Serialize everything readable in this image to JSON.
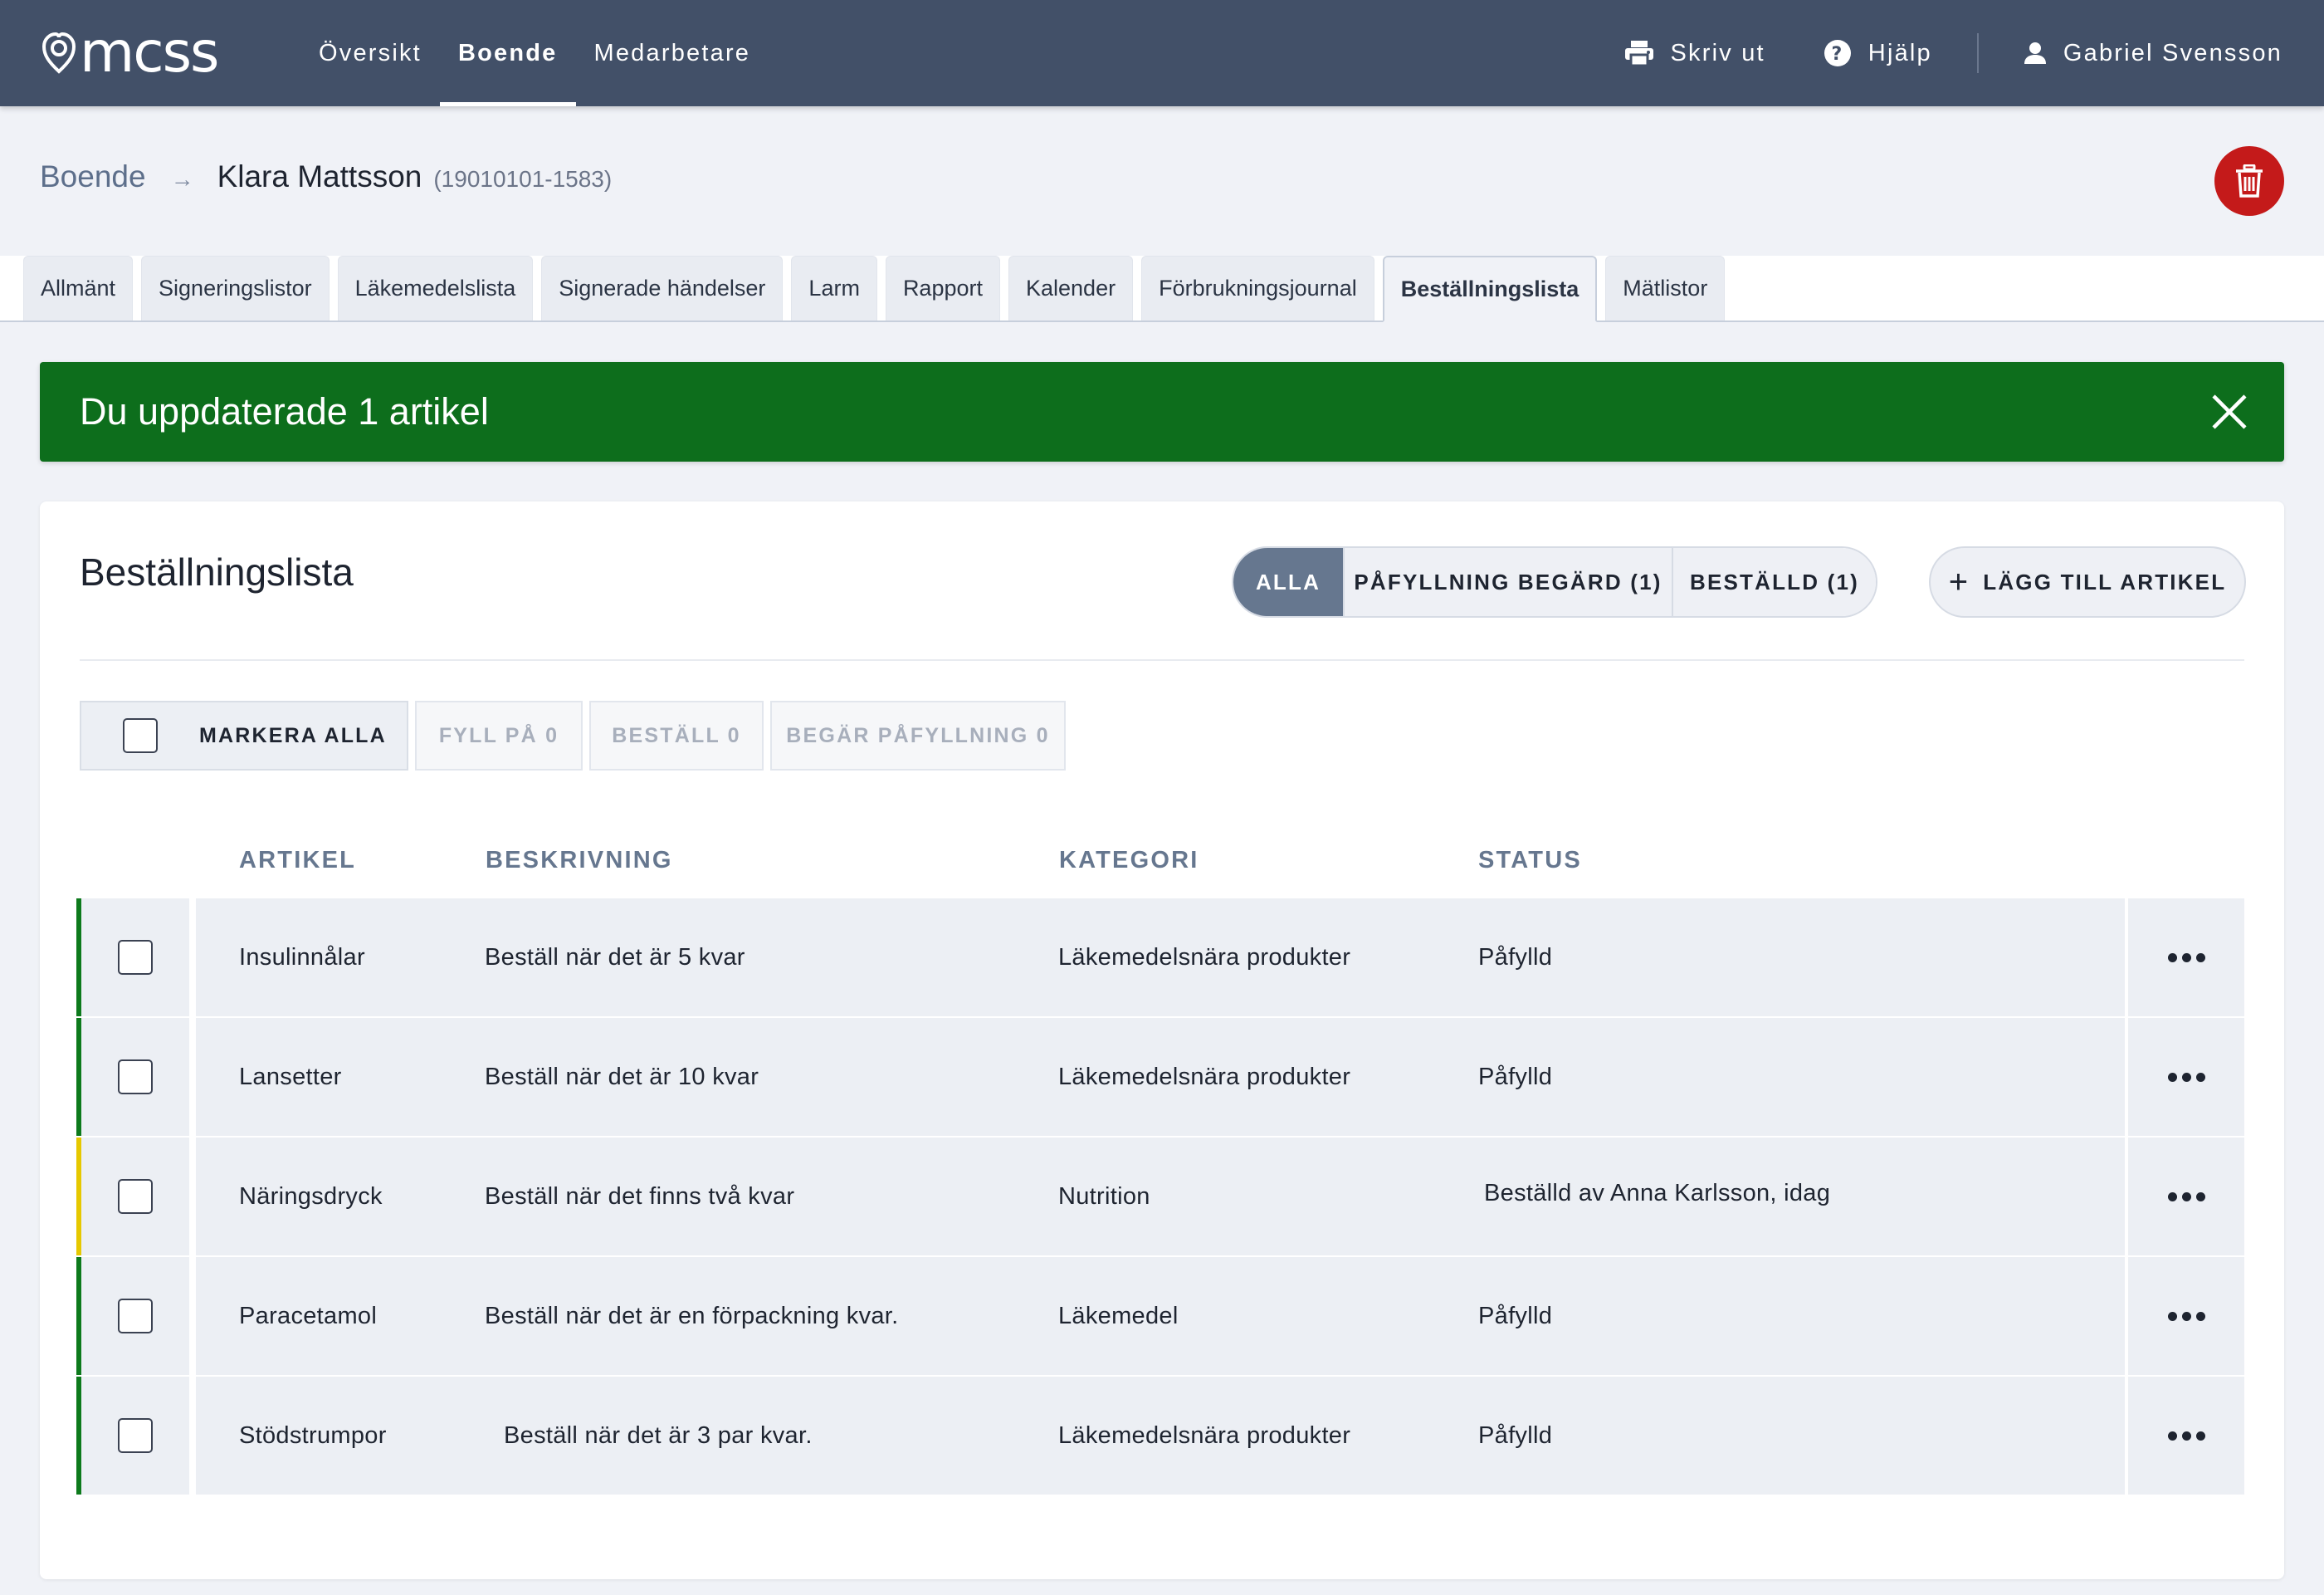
{
  "app": {
    "logo_text": "mcss"
  },
  "nav": {
    "items": [
      {
        "label": "Översikt",
        "active": false
      },
      {
        "label": "Boende",
        "active": true
      },
      {
        "label": "Medarbetare",
        "active": false
      }
    ],
    "print_label": "Skriv ut",
    "help_label": "Hjälp",
    "user_name": "Gabriel Svensson"
  },
  "header": {
    "breadcrumb_root": "Boende",
    "resident_name": "Klara Mattsson",
    "resident_id": "(19010101-1583)"
  },
  "tabs": [
    {
      "label": "Allmänt"
    },
    {
      "label": "Signeringslistor"
    },
    {
      "label": "Läkemedelslista"
    },
    {
      "label": "Signerade händelser"
    },
    {
      "label": "Larm"
    },
    {
      "label": "Rapport"
    },
    {
      "label": "Kalender"
    },
    {
      "label": "Förbrukningsjournal"
    },
    {
      "label": "Beställningslista",
      "active": true
    },
    {
      "label": "Mätlistor"
    }
  ],
  "alert": {
    "message": "Du uppdaterade 1 artikel",
    "color": "#0d6e1c"
  },
  "card": {
    "title": "Beställningslista",
    "filters": [
      {
        "label": "ALLA",
        "active": true
      },
      {
        "label": "PÅFYLLNING BEGÄRD (1)",
        "active": false
      },
      {
        "label": "BESTÄLLD (1)",
        "active": false
      }
    ],
    "add_label": "LÄGG TILL ARTIKEL",
    "actions": {
      "select_all": "MARKERA ALLA",
      "refill": "FYLL PÅ 0",
      "order": "BESTÄLL 0",
      "request_refill": "BEGÄR PÅFYLLNING 0"
    }
  },
  "table": {
    "columns": [
      "ARTIKEL",
      "BESKRIVNING",
      "KATEGORI",
      "STATUS"
    ],
    "rows": [
      {
        "article": "Insulinnålar",
        "description": "Beställ när det är 5 kvar",
        "category": "Läkemedelsnära produkter",
        "status": "Påfylld",
        "status_color": "#0d7a1c"
      },
      {
        "article": "Lansetter",
        "description": "Beställ när det är 10 kvar",
        "category": "Läkemedelsnära produkter",
        "status": "Påfylld",
        "status_color": "#0d7a1c"
      },
      {
        "article": "Näringsdryck",
        "description": "Beställ när det finns två kvar",
        "category": "Nutrition",
        "status": "Beställd av Anna Karlsson, idag",
        "status_color": "#e6c800"
      },
      {
        "article": "Paracetamol",
        "description": "Beställ när det är en förpackning kvar.",
        "category": "Läkemedel",
        "status": "Påfylld",
        "status_color": "#0d7a1c"
      },
      {
        "article": "Stödstrumpor",
        "description": "Beställ när det är 3 par kvar.",
        "category": "Läkemedelsnära produkter",
        "status": "Påfylld",
        "status_color": "#0d7a1c"
      }
    ]
  }
}
